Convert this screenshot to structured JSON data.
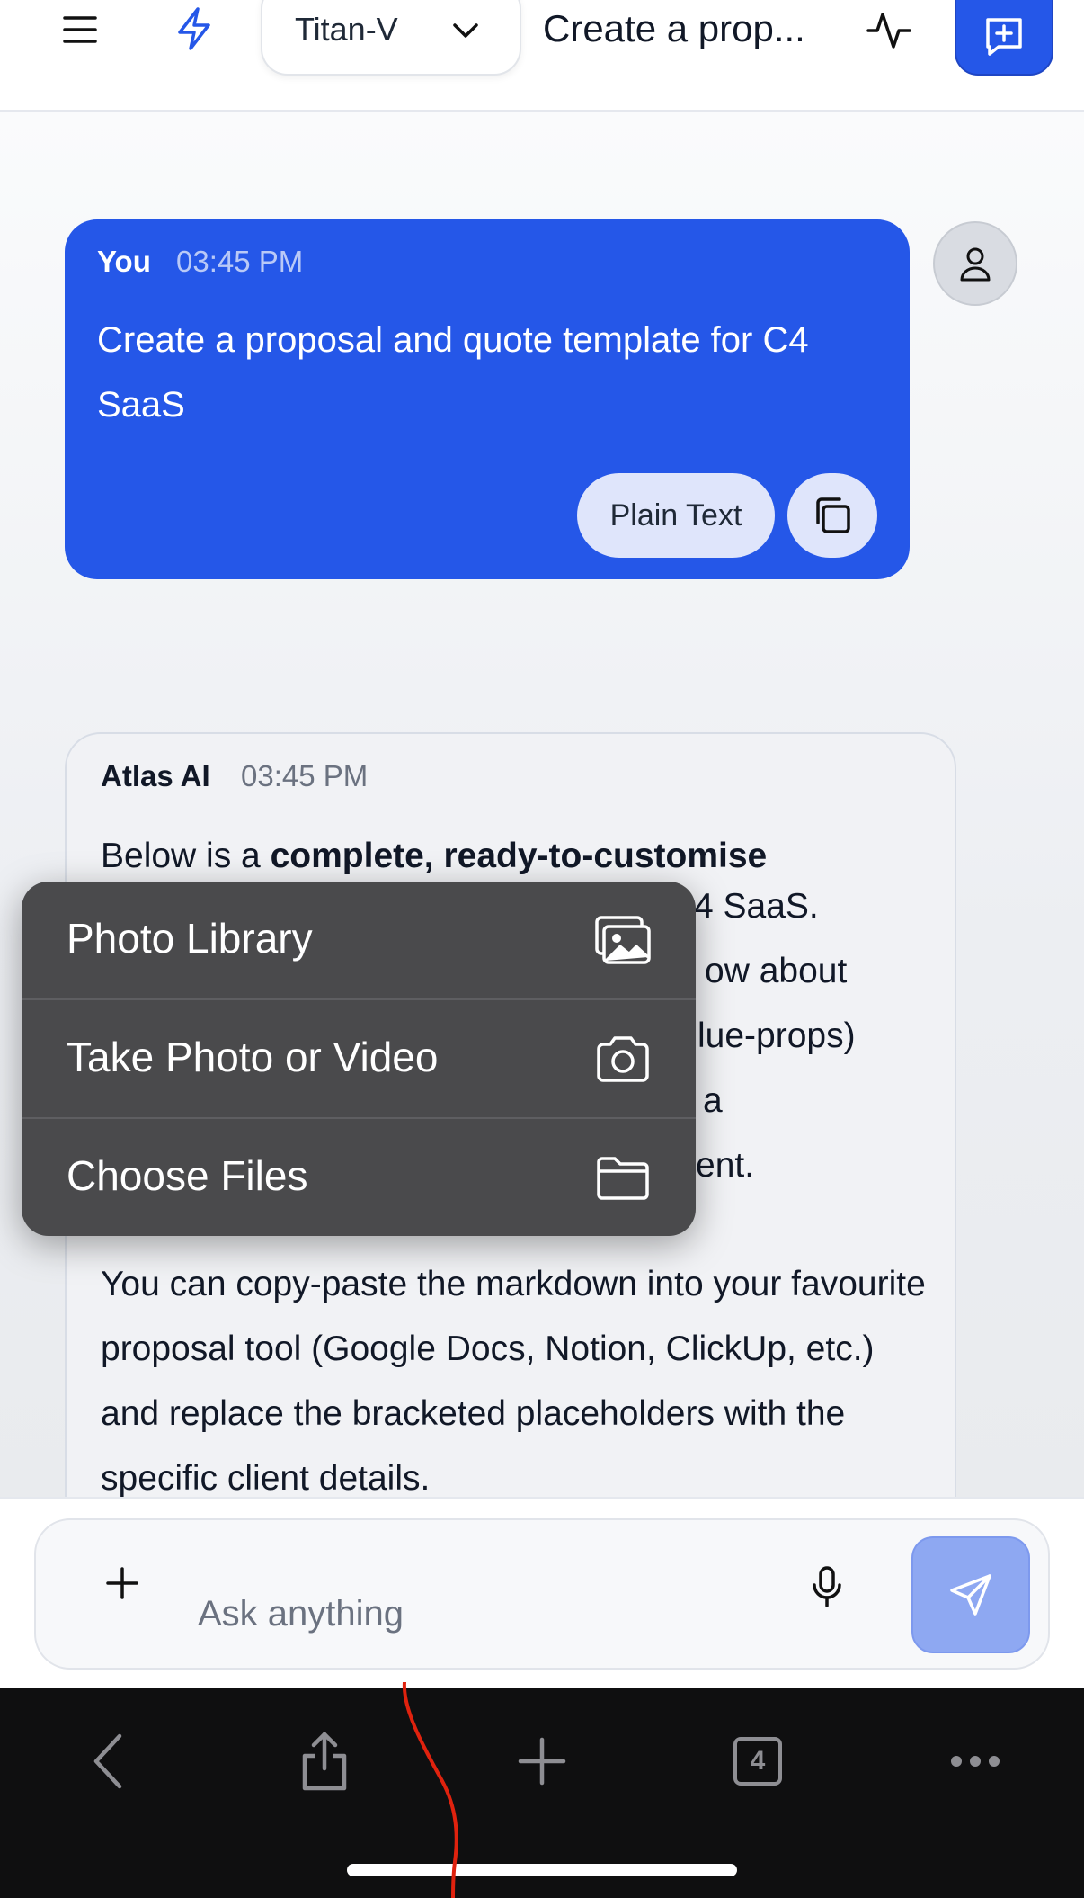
{
  "header": {
    "model": "Titan-V",
    "title": "Create a prop...",
    "icons": [
      "menu-icon",
      "bolt-icon",
      "chevron-down-icon",
      "activity-icon",
      "new-chat-icon"
    ]
  },
  "user_message": {
    "sender": "You",
    "time": "03:45 PM",
    "text": "Create a proposal and quote template for C4 SaaS",
    "plain_text_label": "Plain Text"
  },
  "ai_message": {
    "sender": "Atlas AI",
    "time": "03:45 PM",
    "intro_prefix": "Below is a ",
    "intro_bold": "complete, ready-to-customise",
    "visible_fragments": [
      "4 SaaS.",
      "ow about",
      "lue-props)",
      "a",
      "ent."
    ],
    "paragraph2": "You can copy-paste the markdown into your favourite proposal tool (Google Docs, Notion, ClickUp, etc.) and replace the bracketed placeholders with the specific client details."
  },
  "context_menu": {
    "items": [
      {
        "label": "Photo Library",
        "icon": "photo-library-icon"
      },
      {
        "label": "Take Photo or Video",
        "icon": "camera-icon"
      },
      {
        "label": "Choose Files",
        "icon": "folder-icon"
      }
    ]
  },
  "input": {
    "placeholder": "Ask anything"
  },
  "browser": {
    "tab_count": "4"
  },
  "colors": {
    "accent": "#2557e8",
    "send_disabled": "#8ea8f2",
    "menu_bg": "#4a4a4c",
    "toolbar_bg": "#0f0f10"
  }
}
